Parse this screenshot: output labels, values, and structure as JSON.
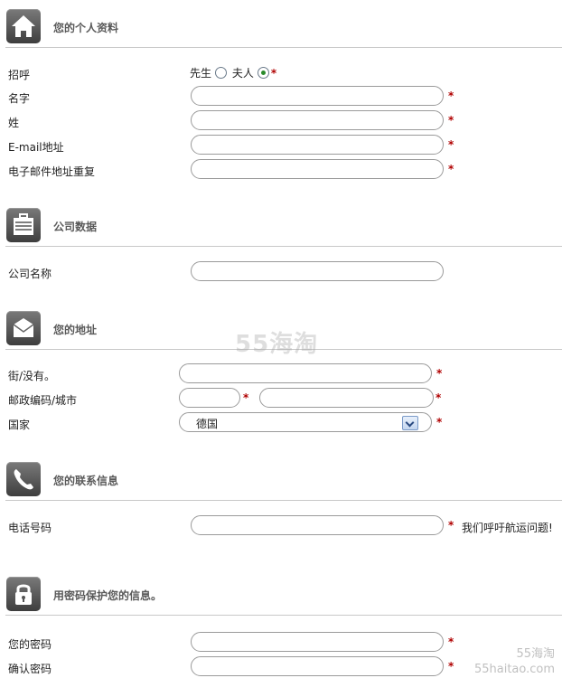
{
  "personal": {
    "title": "您的个人资料",
    "salutation_label": "招呼",
    "mr_label": "先生",
    "mrs_label": "夫人",
    "first_name_label": "名字",
    "last_name_label": "姓",
    "email_label": "E-mail地址",
    "email_repeat_label": "电子邮件地址重复"
  },
  "company": {
    "title": "公司数据",
    "name_label": "公司名称"
  },
  "address": {
    "title": "您的地址",
    "street_label": "街/没有。",
    "zip_city_label": "邮政编码/城市",
    "country_label": "国家",
    "country_value": "德国"
  },
  "contact": {
    "title": "您的联系信息",
    "phone_label": "电话号码",
    "phone_note": "我们呼吁航运问题!"
  },
  "password": {
    "title": "用密码保护您的信息。",
    "password_label": "您的密码",
    "confirm_label": "确认密码"
  },
  "required_mark": "*",
  "watermark": {
    "center": "55海淘",
    "corner_top": "55海淘",
    "corner_bottom": "55haitao.com"
  },
  "icons": {
    "personal": "home-icon",
    "company": "briefcase-icon",
    "address": "envelope-icon",
    "contact": "phone-icon",
    "password": "lock-icon"
  }
}
